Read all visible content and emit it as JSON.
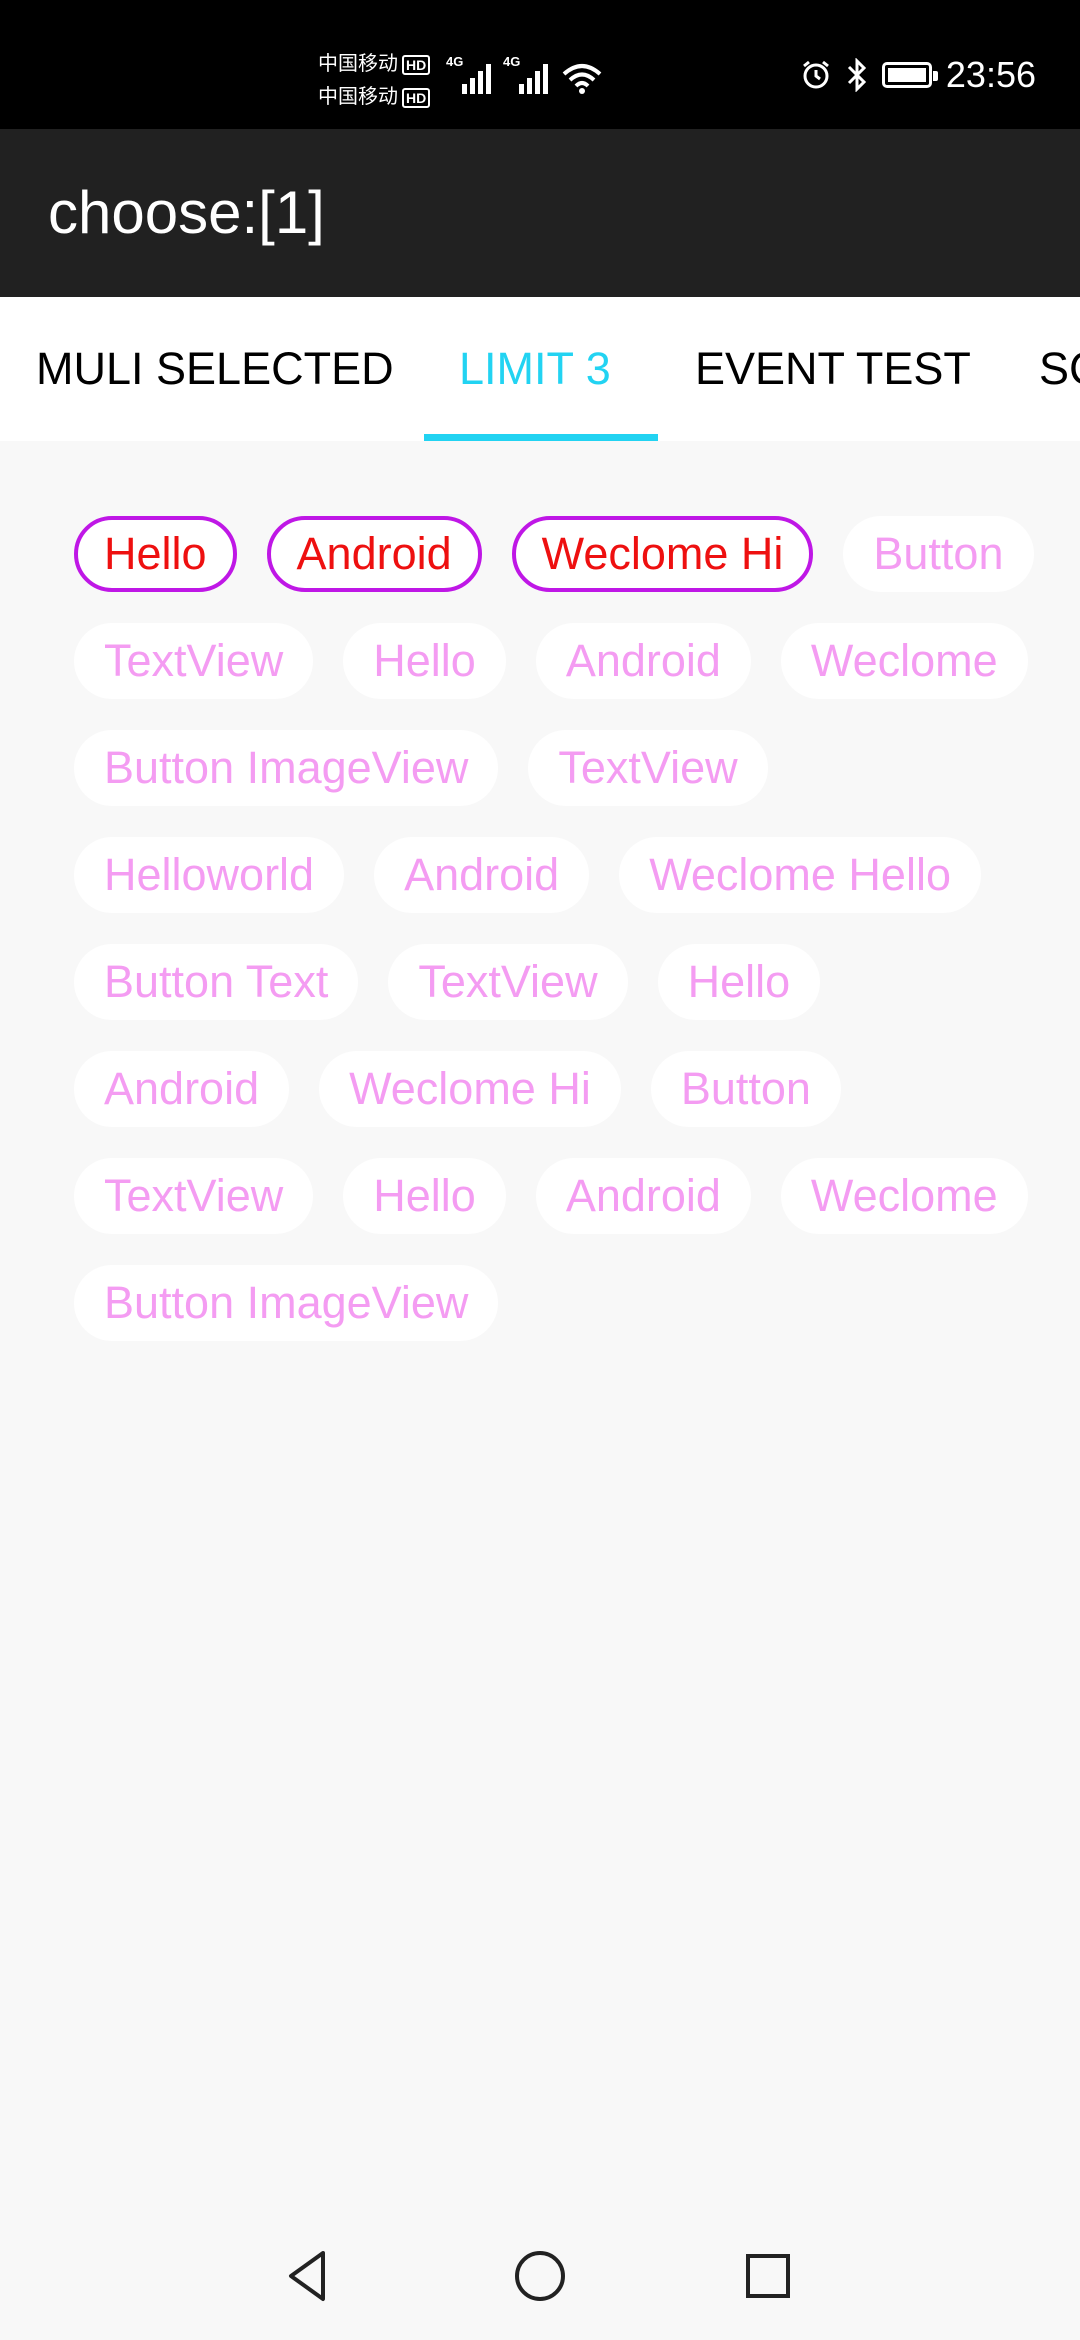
{
  "status_bar": {
    "carrier_1": "中国移动",
    "carrier_2": "中国移动",
    "hd_badge": "HD",
    "network_1": "4G",
    "network_2": "4G",
    "time": "23:56",
    "icons": [
      "alarm-icon",
      "bluetooth-icon",
      "battery-charging-icon",
      "wifi-icon",
      "signal-icon"
    ]
  },
  "app_bar": {
    "title": "choose:[1]"
  },
  "tabs": [
    {
      "label": "MULI SELECTED",
      "active": false
    },
    {
      "label": "LIMIT 3",
      "active": true
    },
    {
      "label": "EVENT TEST",
      "active": false
    },
    {
      "label": "SC",
      "active": false
    }
  ],
  "colors": {
    "accent": "#22d3f2",
    "tag_text": "#f49cf2",
    "selected_border": "#bf17e6",
    "selected_text": "#ee1010"
  },
  "tags": [
    {
      "label": "Hello",
      "selected": true
    },
    {
      "label": "Android",
      "selected": true
    },
    {
      "label": "Weclome Hi",
      "selected": true
    },
    {
      "label": "Button",
      "selected": false
    },
    {
      "label": "TextView",
      "selected": false
    },
    {
      "label": "Hello",
      "selected": false
    },
    {
      "label": "Android",
      "selected": false
    },
    {
      "label": "Weclome",
      "selected": false
    },
    {
      "label": "Button ImageView",
      "selected": false
    },
    {
      "label": "TextView",
      "selected": false
    },
    {
      "label": "Helloworld",
      "selected": false
    },
    {
      "label": "Android",
      "selected": false
    },
    {
      "label": "Weclome Hello",
      "selected": false
    },
    {
      "label": "Button Text",
      "selected": false
    },
    {
      "label": "TextView",
      "selected": false
    },
    {
      "label": "Hello",
      "selected": false
    },
    {
      "label": "Android",
      "selected": false
    },
    {
      "label": "Weclome Hi",
      "selected": false
    },
    {
      "label": "Button",
      "selected": false
    },
    {
      "label": "TextView",
      "selected": false
    },
    {
      "label": "Hello",
      "selected": false
    },
    {
      "label": "Android",
      "selected": false
    },
    {
      "label": "Weclome",
      "selected": false
    },
    {
      "label": "Button ImageView",
      "selected": false
    }
  ],
  "nav_bar": {
    "buttons": [
      "back-icon",
      "home-icon",
      "recents-icon"
    ]
  }
}
